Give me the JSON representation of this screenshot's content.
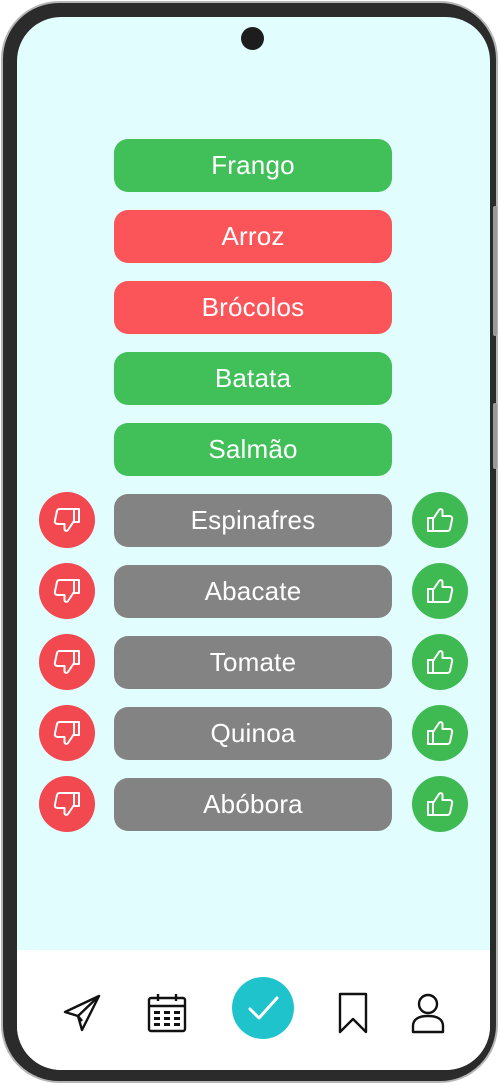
{
  "foods": {
    "rated": [
      {
        "label": "Frango",
        "status": "liked",
        "color": "#41c05a"
      },
      {
        "label": "Arroz",
        "status": "disliked",
        "color": "#fb555a"
      },
      {
        "label": "Brócolos",
        "status": "disliked",
        "color": "#fb555a"
      },
      {
        "label": "Batata",
        "status": "liked",
        "color": "#41c05a"
      },
      {
        "label": "Salmão",
        "status": "liked",
        "color": "#41c05a"
      }
    ],
    "pending": [
      {
        "label": "Espinafres"
      },
      {
        "label": "Abacate"
      },
      {
        "label": "Tomate"
      },
      {
        "label": "Quinoa"
      },
      {
        "label": "Abóbora"
      }
    ],
    "pending_color": "#838383",
    "dislike_icon": "thumbs-down-icon",
    "like_icon": "thumbs-up-icon"
  },
  "bottom_nav": {
    "items": [
      "paper-plane-icon",
      "calendar-icon",
      "checkmark-icon",
      "bookmark-icon",
      "user-icon"
    ],
    "active": "checkmark-icon",
    "accent": "#1fc3cc"
  }
}
